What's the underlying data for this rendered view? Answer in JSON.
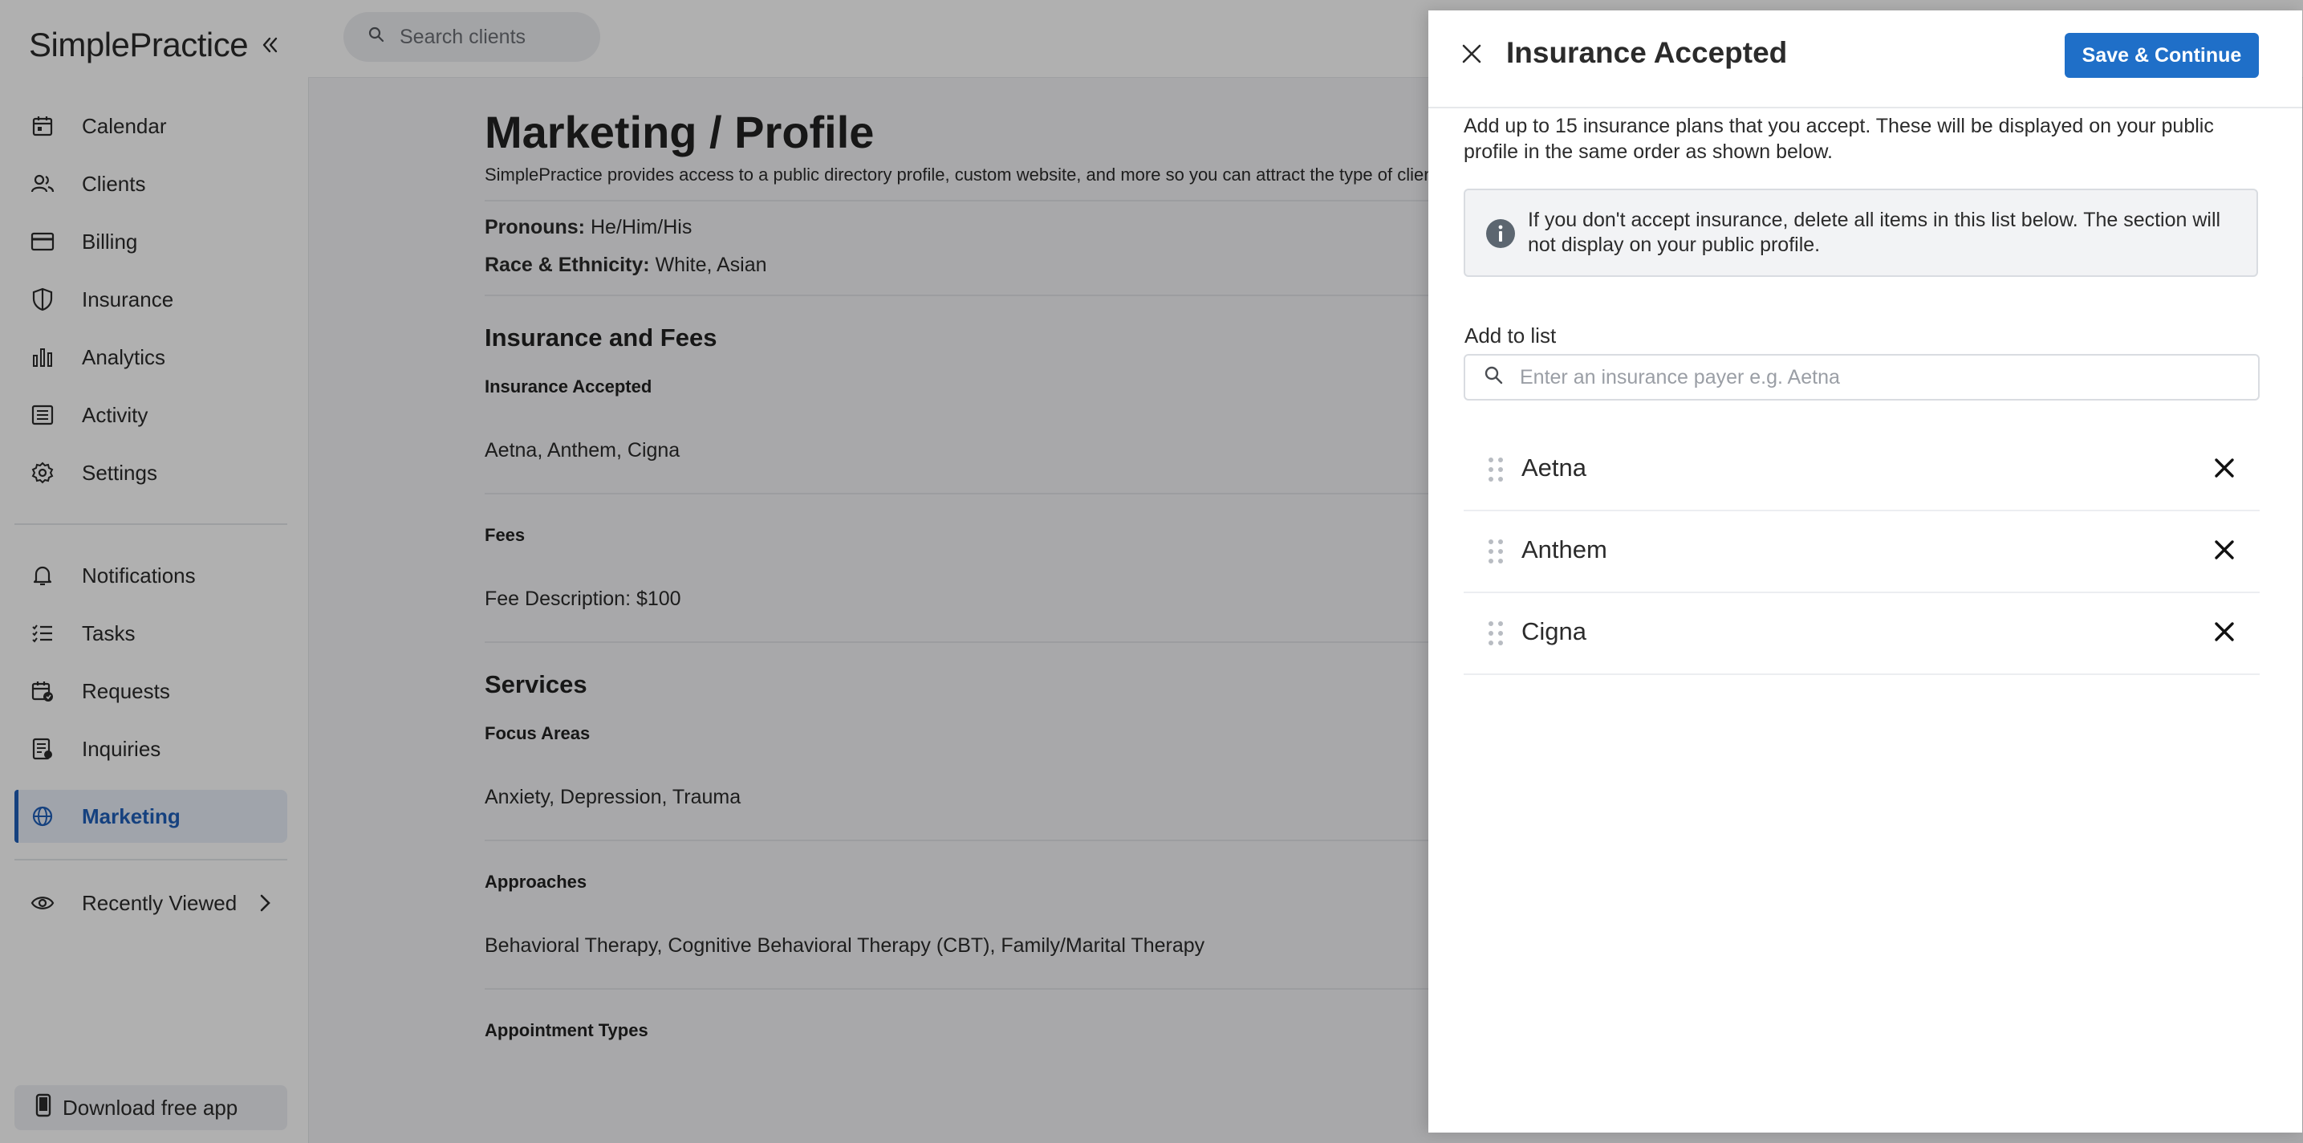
{
  "brand": {
    "name": "SimplePractice"
  },
  "sidebar": {
    "items": [
      {
        "label": "Calendar",
        "icon": "calendar-icon"
      },
      {
        "label": "Clients",
        "icon": "clients-icon"
      },
      {
        "label": "Billing",
        "icon": "billing-icon"
      },
      {
        "label": "Insurance",
        "icon": "shield-icon"
      },
      {
        "label": "Analytics",
        "icon": "analytics-icon"
      },
      {
        "label": "Activity",
        "icon": "activity-icon"
      },
      {
        "label": "Settings",
        "icon": "gear-icon"
      }
    ],
    "items2": [
      {
        "label": "Notifications",
        "icon": "bell-icon"
      },
      {
        "label": "Tasks",
        "icon": "tasks-icon"
      },
      {
        "label": "Requests",
        "icon": "requests-icon"
      },
      {
        "label": "Inquiries",
        "icon": "inquiries-icon"
      }
    ],
    "active": {
      "label": "Marketing",
      "icon": "globe-icon"
    },
    "recently_viewed": "Recently Viewed",
    "download_app": "Download free app"
  },
  "topbar": {
    "search_placeholder": "Search clients"
  },
  "main": {
    "title": "Marketing / Profile",
    "subtitle": "SimplePractice provides access to a public directory profile, custom website, and more so you can attract the type of clients",
    "pronouns_label": "Pronouns:",
    "pronouns_value": "He/Him/His",
    "race_label": "Race & Ethnicity:",
    "race_value": "White, Asian",
    "insurance_fees_heading": "Insurance and Fees",
    "insurance_accepted_label": "Insurance Accepted",
    "insurance_accepted_value": "Aetna, Anthem, Cigna",
    "fees_label": "Fees",
    "fees_value": "Fee Description: $100",
    "services_heading": "Services",
    "focus_areas_label": "Focus Areas",
    "focus_areas_value": "Anxiety, Depression, Trauma",
    "approaches_label": "Approaches",
    "approaches_value": "Behavioral Therapy, Cognitive Behavioral Therapy (CBT), Family/Marital Therapy",
    "appointment_types_label": "Appointment Types"
  },
  "drawer": {
    "title": "Insurance Accepted",
    "save_label": "Save & Continue",
    "intro": "Add up to 15 insurance plans that you accept. These will be displayed on your public profile in the same order as shown below.",
    "info": "If you don't accept insurance, delete all items in this list below. The section will not display on your public profile.",
    "add_label": "Add to list",
    "input_placeholder": "Enter an insurance payer e.g. Aetna",
    "plans": [
      "Aetna",
      "Anthem",
      "Cigna"
    ]
  },
  "colors": {
    "accent": "#1f6fc8",
    "active_nav": "#1f5fb8"
  }
}
